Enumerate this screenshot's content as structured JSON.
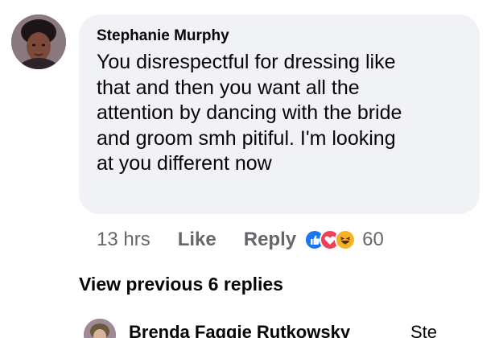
{
  "comment": {
    "author": "Stephanie Murphy",
    "text_lines": [
      "You  disrespectful for dressing like",
      "that and then you want all the",
      "attention by dancing with the bride",
      "and groom  smh pitiful.  I'm looking",
      "at you different now"
    ],
    "time": "13 hrs",
    "like_label": "Like",
    "reply_label": "Reply",
    "reaction_icons": [
      "like-reaction",
      "love-reaction",
      "haha-reaction"
    ],
    "reaction_count": "60"
  },
  "view_previous_label": "View previous 6 replies",
  "next_reply": {
    "author": "Brenda Faggie Rutkowsky",
    "preview": "Ste"
  },
  "colors": {
    "bubble_bg": "#f0f2f5",
    "text": "#050505",
    "secondary_text": "#65676b",
    "like_blue": "#1877f2",
    "love_red": "#f33e58",
    "haha_yellow": "#f7b125"
  }
}
